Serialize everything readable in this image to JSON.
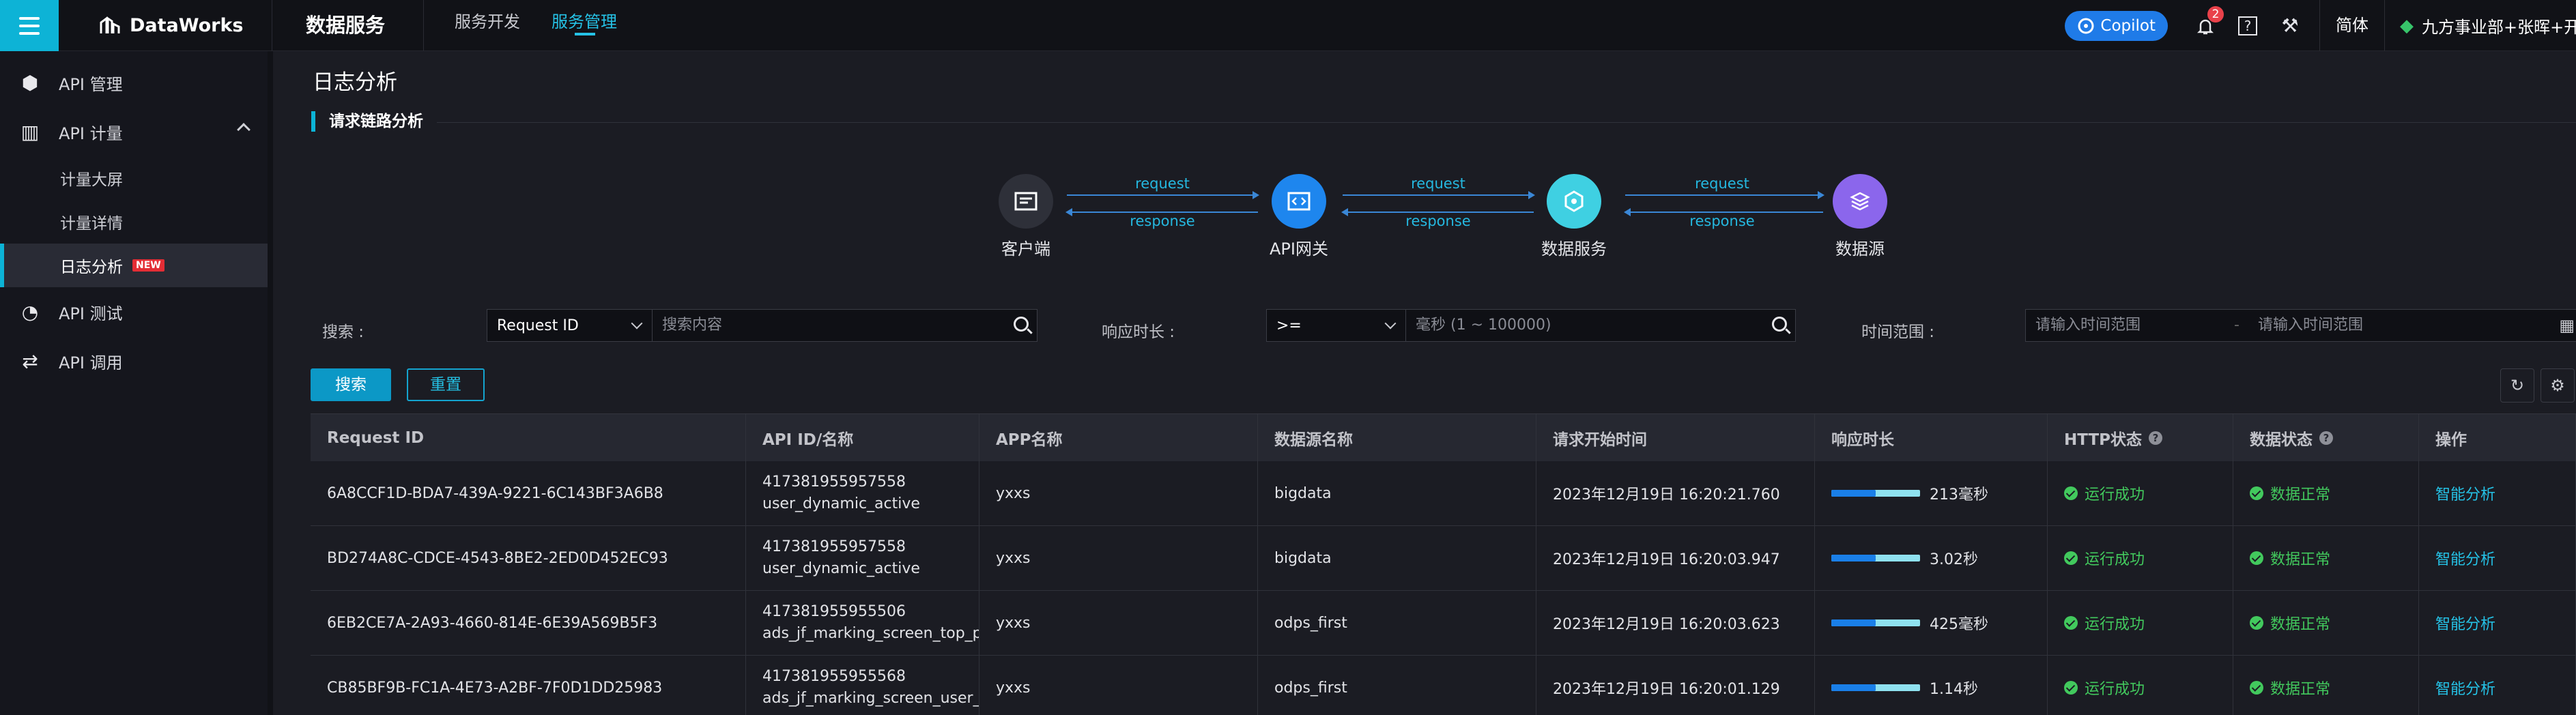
{
  "app": {
    "brand": "DataWorks",
    "product": "数据服务",
    "nav": [
      {
        "label": "服务开发"
      },
      {
        "label": "服务管理"
      }
    ],
    "copilot": "Copilot",
    "notifications": "2",
    "lang": "简体",
    "org": "九方事业部+张晖+开发"
  },
  "sidebar": {
    "items": [
      {
        "label": "API 管理"
      },
      {
        "label": "API 计量"
      },
      {
        "label": "计量大屏"
      },
      {
        "label": "计量详情"
      },
      {
        "label": "日志分析",
        "badge": "NEW"
      },
      {
        "label": "API 测试"
      },
      {
        "label": "API 调用"
      }
    ]
  },
  "page": {
    "title": "日志分析",
    "section": "请求链路分析"
  },
  "flow": {
    "nodes": [
      {
        "label": "客户端"
      },
      {
        "label": "API网关"
      },
      {
        "label": "数据服务"
      },
      {
        "label": "数据源"
      }
    ],
    "request": "request",
    "response": "response"
  },
  "filters": {
    "search_label": "搜索 :",
    "search_field": "Request ID",
    "search_placeholder": "搜索内容",
    "resp_label": "响应时长 :",
    "resp_op": ">=",
    "resp_placeholder": "毫秒 (1 ~ 100000)",
    "time_label": "时间范围 :",
    "time_start": "请输入时间范围",
    "time_end": "请输入时间范围"
  },
  "buttons": {
    "search": "搜索",
    "reset": "重置"
  },
  "table": {
    "headers": [
      "Request ID",
      "API ID/名称",
      "APP名称",
      "数据源名称",
      "请求开始时间",
      "响应时长",
      "HTTP状态",
      "数据状态",
      "操作"
    ],
    "rows": [
      {
        "id": "6A8CCF1D-BDA7-439A-9221-6C143BF3A6B8",
        "api_id": "417381955957558",
        "api_name": "user_dynamic_active",
        "app": "yxxs",
        "ds": "bigdata",
        "time": "2023年12月19日 16:20:21.760",
        "dur": "213毫秒",
        "fill": 0.5,
        "http": "运行成功",
        "data": "数据正常",
        "op": "智能分析"
      },
      {
        "id": "BD274A8C-CDCE-4543-8BE2-2ED0D452EC93",
        "api_id": "417381955957558",
        "api_name": "user_dynamic_active",
        "app": "yxxs",
        "ds": "bigdata",
        "time": "2023年12月19日 16:20:03.947",
        "dur": "3.02秒",
        "fill": 0.5,
        "http": "运行成功",
        "data": "数据正常",
        "op": "智能分析"
      },
      {
        "id": "6EB2CE7A-2A93-4660-814E-6E39A569B5F3",
        "api_id": "417381955955506",
        "api_name": "ads_jf_marking_screen_top_pl",
        "app": "yxxs",
        "ds": "odps_first",
        "time": "2023年12月19日 16:20:03.623",
        "dur": "425毫秒",
        "fill": 0.5,
        "http": "运行成功",
        "data": "数据正常",
        "op": "智能分析"
      },
      {
        "id": "CB85BF9B-FC1A-4E73-A2BF-7F0D1DD25983",
        "api_id": "417381955955568",
        "api_name": "ads_jf_marking_screen_user_c",
        "app": "yxxs",
        "ds": "odps_first",
        "time": "2023年12月19日 16:20:01.129",
        "dur": "1.14秒",
        "fill": 0.5,
        "http": "运行成功",
        "data": "数据正常",
        "op": "智能分析"
      }
    ]
  }
}
